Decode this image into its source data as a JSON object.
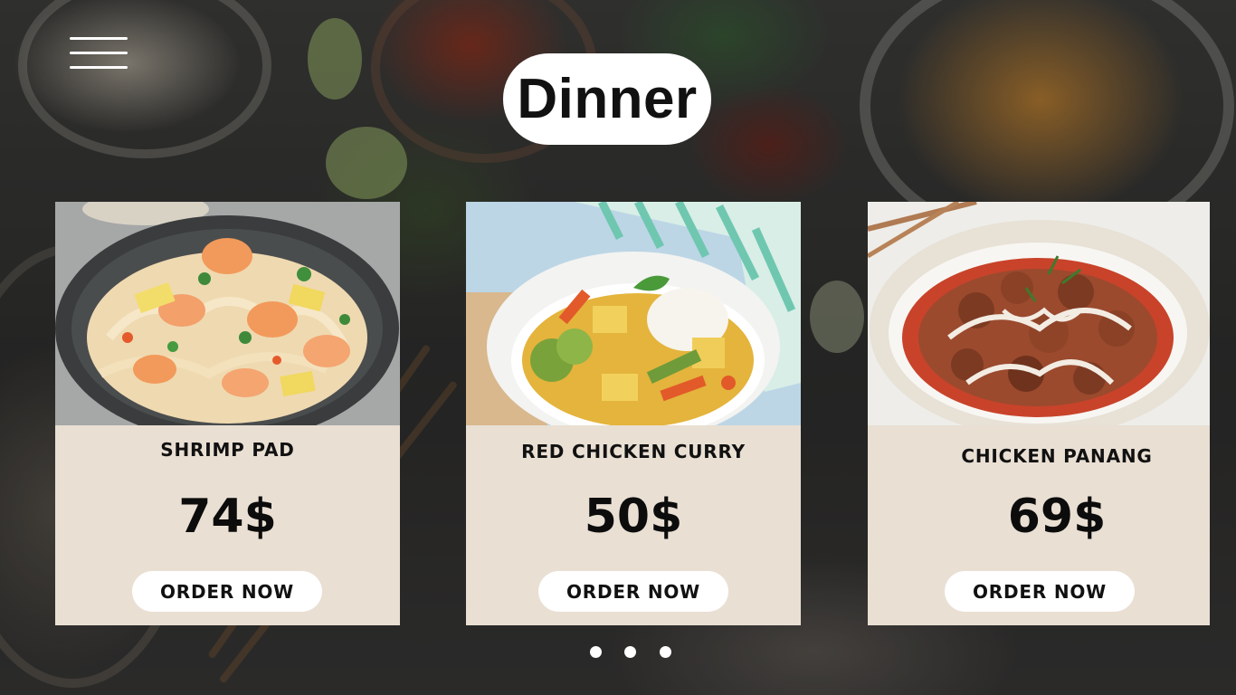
{
  "page": {
    "title": "Dinner"
  },
  "menu": {
    "icon": "hamburger-menu-icon"
  },
  "cards": [
    {
      "name": "SHRIMP PAD",
      "price": "74$",
      "order_label": "ORDER NOW",
      "image": "shrimp-pad-thai-photo"
    },
    {
      "name": "RED CHICKEN CURRY",
      "price": "50$",
      "order_label": "ORDER NOW",
      "image": "red-chicken-curry-photo"
    },
    {
      "name": "CHICKEN PANANG",
      "price": "69$",
      "order_label": "ORDER NOW",
      "image": "chicken-panang-photo"
    }
  ],
  "carousel": {
    "dot_count": 3
  },
  "colors": {
    "card_background": "#e9dfd3",
    "button_background": "#ffffff",
    "text": "#111111",
    "title_pill": "#ffffff"
  }
}
